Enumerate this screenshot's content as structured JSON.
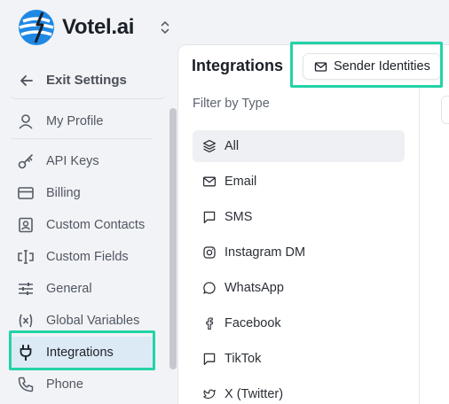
{
  "brand": {
    "name": "Votel.ai",
    "accent": "#1E88E5",
    "switcher_icon": "chevron-up-down-icon"
  },
  "sidebar": {
    "exit_label": "Exit Settings",
    "items": [
      {
        "label": "My Profile",
        "icon": "user-icon"
      },
      {
        "label": "API Keys",
        "icon": "key-icon"
      },
      {
        "label": "Billing",
        "icon": "credit-card-icon"
      },
      {
        "label": "Custom Contacts",
        "icon": "contact-card-icon"
      },
      {
        "label": "Custom Fields",
        "icon": "text-cursor-icon"
      },
      {
        "label": "General",
        "icon": "sliders-icon"
      },
      {
        "label": "Global Variables",
        "icon": "variable-icon"
      },
      {
        "label": "Integrations",
        "icon": "plug-icon",
        "active": true
      },
      {
        "label": "Phone",
        "icon": "phone-icon"
      }
    ]
  },
  "main": {
    "title": "Integrations",
    "tab_label": "Sender Identities",
    "filter_heading": "Filter by Type",
    "filters": [
      {
        "label": "All",
        "icon": "layers-icon",
        "active": true
      },
      {
        "label": "Email",
        "icon": "mail-icon"
      },
      {
        "label": "SMS",
        "icon": "message-square-icon"
      },
      {
        "label": "Instagram DM",
        "icon": "instagram-icon"
      },
      {
        "label": "WhatsApp",
        "icon": "message-circle-icon"
      },
      {
        "label": "Facebook",
        "icon": "facebook-icon"
      },
      {
        "label": "TikTok",
        "icon": "message-square-icon"
      },
      {
        "label": "X (Twitter)",
        "icon": "twitter-icon"
      }
    ]
  },
  "highlight_color": "#22D3A6"
}
